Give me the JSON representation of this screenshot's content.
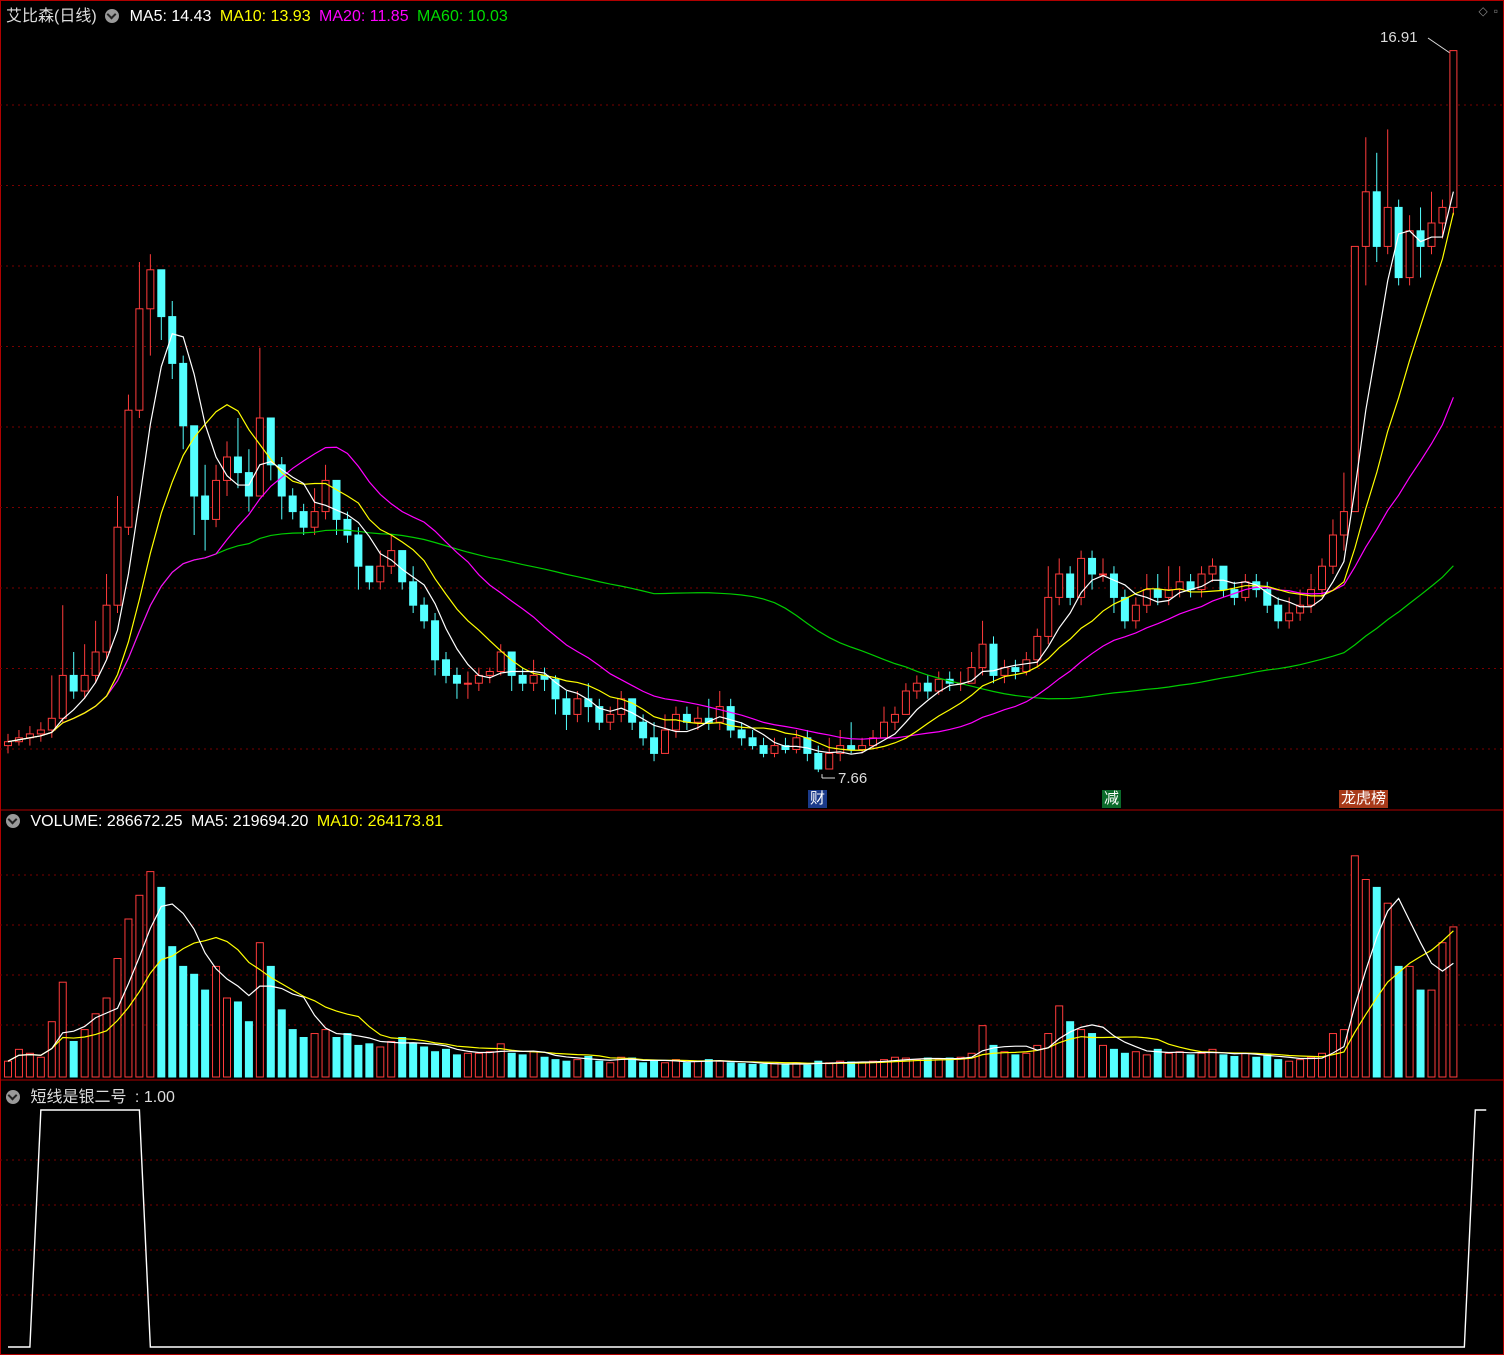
{
  "header": {
    "stock_name": "艾比森(日线)",
    "ma5": "MA5: 14.43",
    "ma10": "MA10: 13.93",
    "ma20": "MA20: 11.85",
    "ma60": "MA60: 10.03"
  },
  "volume_header": {
    "volume": "VOLUME: 286672.25",
    "ma5": "MA5: 219694.20",
    "ma10": "MA10: 264173.81"
  },
  "indicator_header": {
    "name": "短线是银二号",
    "value": ": 1.00"
  },
  "annotations": {
    "high_label": "16.91",
    "low_label": "7.66",
    "event_cai": "财",
    "event_jian": "减",
    "event_longhu": "龙虎榜"
  },
  "colors": {
    "up": "#ff3b3b",
    "down": "#54ffff",
    "ma5": "#ffffff",
    "ma10": "#ffff00",
    "ma20": "#ff00ff",
    "ma60": "#00cc00",
    "grid": "#7a0000",
    "panel_border": "#b00000"
  },
  "chart_data": {
    "type": "candlestick",
    "price_range": [
      7.2,
      17.2
    ],
    "candles": [
      [
        8.0,
        8.05,
        7.9,
        8.15
      ],
      [
        8.05,
        8.1,
        8.0,
        8.2
      ],
      [
        8.1,
        8.15,
        8.0,
        8.25
      ],
      [
        8.15,
        8.2,
        8.05,
        8.3
      ],
      [
        8.2,
        8.35,
        8.1,
        8.9
      ],
      [
        8.35,
        8.9,
        8.3,
        9.8
      ],
      [
        8.9,
        8.7,
        8.6,
        9.2
      ],
      [
        8.7,
        8.9,
        8.6,
        9.3
      ],
      [
        8.9,
        9.2,
        8.8,
        9.6
      ],
      [
        9.2,
        9.8,
        9.1,
        10.2
      ],
      [
        9.8,
        10.8,
        9.7,
        11.2
      ],
      [
        10.8,
        12.3,
        10.7,
        12.5
      ],
      [
        12.3,
        13.6,
        12.2,
        14.2
      ],
      [
        13.6,
        14.1,
        13.0,
        14.3
      ],
      [
        14.1,
        13.5,
        13.2,
        14.0
      ],
      [
        13.5,
        12.9,
        12.7,
        13.7
      ],
      [
        12.9,
        12.1,
        11.8,
        13.0
      ],
      [
        12.1,
        11.2,
        10.7,
        11.4
      ],
      [
        11.2,
        10.9,
        10.5,
        11.6
      ],
      [
        10.9,
        11.4,
        10.8,
        11.6
      ],
      [
        11.4,
        11.7,
        11.2,
        11.9
      ],
      [
        11.7,
        11.5,
        11.3,
        12.2
      ],
      [
        11.5,
        11.2,
        11.0,
        11.8
      ],
      [
        11.2,
        12.2,
        11.2,
        13.1
      ],
      [
        12.2,
        11.6,
        11.4,
        12.2
      ],
      [
        11.6,
        11.2,
        10.9,
        11.7
      ],
      [
        11.2,
        11.0,
        10.9,
        11.3
      ],
      [
        11.0,
        10.8,
        10.7,
        11.1
      ],
      [
        10.8,
        11.0,
        10.7,
        11.3
      ],
      [
        11.0,
        11.4,
        10.9,
        11.6
      ],
      [
        11.4,
        10.9,
        10.7,
        11.4
      ],
      [
        10.9,
        10.7,
        10.6,
        11.0
      ],
      [
        10.7,
        10.3,
        10.0,
        10.8
      ],
      [
        10.3,
        10.1,
        10.0,
        10.3
      ],
      [
        10.1,
        10.3,
        10.0,
        10.5
      ],
      [
        10.3,
        10.5,
        10.2,
        10.7
      ],
      [
        10.5,
        10.1,
        10.0,
        10.5
      ],
      [
        10.1,
        9.8,
        9.7,
        10.3
      ],
      [
        9.8,
        9.6,
        9.5,
        9.9
      ],
      [
        9.6,
        9.1,
        8.9,
        9.7
      ],
      [
        9.1,
        8.9,
        8.8,
        9.2
      ],
      [
        8.9,
        8.8,
        8.6,
        9.0
      ],
      [
        8.8,
        8.8,
        8.6,
        8.95
      ],
      [
        8.8,
        8.9,
        8.7,
        9.0
      ],
      [
        8.9,
        8.95,
        8.8,
        9.0
      ],
      [
        8.95,
        9.2,
        8.9,
        9.3
      ],
      [
        9.2,
        8.9,
        8.7,
        9.2
      ],
      [
        8.9,
        8.8,
        8.7,
        9.0
      ],
      [
        8.8,
        8.9,
        8.7,
        9.1
      ],
      [
        8.9,
        8.85,
        8.7,
        9.0
      ],
      [
        8.85,
        8.6,
        8.4,
        8.9
      ],
      [
        8.6,
        8.4,
        8.2,
        8.7
      ],
      [
        8.4,
        8.6,
        8.3,
        8.7
      ],
      [
        8.6,
        8.5,
        8.3,
        8.8
      ],
      [
        8.5,
        8.3,
        8.2,
        8.6
      ],
      [
        8.3,
        8.4,
        8.2,
        8.5
      ],
      [
        8.4,
        8.6,
        8.3,
        8.7
      ],
      [
        8.6,
        8.3,
        8.2,
        8.6
      ],
      [
        8.3,
        8.1,
        8.0,
        8.4
      ],
      [
        8.1,
        7.9,
        7.8,
        8.3
      ],
      [
        7.9,
        8.2,
        7.9,
        8.4
      ],
      [
        8.2,
        8.4,
        8.1,
        8.5
      ],
      [
        8.4,
        8.3,
        8.2,
        8.5
      ],
      [
        8.3,
        8.35,
        8.2,
        8.5
      ],
      [
        8.35,
        8.3,
        8.2,
        8.6
      ],
      [
        8.3,
        8.5,
        8.2,
        8.7
      ],
      [
        8.5,
        8.2,
        8.1,
        8.6
      ],
      [
        8.2,
        8.1,
        8.0,
        8.3
      ],
      [
        8.1,
        8.0,
        7.95,
        8.2
      ],
      [
        8.0,
        7.9,
        7.85,
        8.1
      ],
      [
        7.9,
        8.0,
        7.85,
        8.1
      ],
      [
        8.0,
        7.95,
        7.9,
        8.1
      ],
      [
        7.95,
        8.1,
        7.9,
        8.2
      ],
      [
        8.1,
        7.9,
        7.8,
        8.2
      ],
      [
        7.9,
        7.7,
        7.66,
        8.0
      ],
      [
        7.7,
        7.9,
        7.7,
        8.1
      ],
      [
        7.9,
        8.0,
        7.8,
        8.2
      ],
      [
        8.0,
        7.95,
        7.9,
        8.3
      ],
      [
        7.95,
        8.0,
        7.9,
        8.1
      ],
      [
        8.0,
        8.1,
        7.95,
        8.2
      ],
      [
        8.1,
        8.3,
        8.1,
        8.5
      ],
      [
        8.3,
        8.4,
        8.2,
        8.5
      ],
      [
        8.4,
        8.7,
        8.4,
        8.8
      ],
      [
        8.7,
        8.8,
        8.6,
        8.9
      ],
      [
        8.8,
        8.7,
        8.6,
        8.9
      ],
      [
        8.7,
        8.85,
        8.65,
        8.95
      ],
      [
        8.85,
        8.8,
        8.7,
        8.95
      ],
      [
        8.8,
        8.8,
        8.7,
        8.95
      ],
      [
        8.8,
        9.0,
        8.8,
        9.2
      ],
      [
        9.0,
        9.3,
        8.9,
        9.6
      ],
      [
        9.3,
        8.9,
        8.8,
        9.4
      ],
      [
        8.9,
        9.0,
        8.8,
        9.1
      ],
      [
        9.0,
        8.95,
        8.85,
        9.1
      ],
      [
        8.95,
        9.1,
        8.9,
        9.2
      ],
      [
        9.1,
        9.4,
        9.0,
        9.5
      ],
      [
        9.4,
        9.9,
        9.3,
        10.3
      ],
      [
        9.9,
        10.2,
        9.8,
        10.4
      ],
      [
        10.2,
        9.9,
        9.8,
        10.3
      ],
      [
        9.9,
        10.4,
        9.8,
        10.5
      ],
      [
        10.4,
        10.2,
        10.0,
        10.5
      ],
      [
        10.2,
        10.2,
        10.1,
        10.4
      ],
      [
        10.2,
        9.9,
        9.7,
        10.3
      ],
      [
        9.9,
        9.6,
        9.5,
        10.0
      ],
      [
        9.6,
        9.8,
        9.5,
        9.9
      ],
      [
        9.8,
        10.0,
        9.7,
        10.2
      ],
      [
        10.0,
        9.9,
        9.8,
        10.2
      ],
      [
        9.9,
        10.0,
        9.8,
        10.3
      ],
      [
        10.0,
        10.1,
        9.9,
        10.3
      ],
      [
        10.1,
        10.0,
        9.9,
        10.2
      ],
      [
        10.0,
        10.2,
        9.9,
        10.3
      ],
      [
        10.2,
        10.3,
        10.1,
        10.4
      ],
      [
        10.3,
        10.0,
        9.9,
        10.3
      ],
      [
        10.0,
        9.9,
        9.8,
        10.1
      ],
      [
        9.9,
        10.1,
        9.85,
        10.2
      ],
      [
        10.1,
        10.0,
        9.9,
        10.2
      ],
      [
        10.0,
        9.8,
        9.7,
        10.1
      ],
      [
        9.8,
        9.6,
        9.5,
        9.9
      ],
      [
        9.6,
        9.7,
        9.5,
        9.9
      ],
      [
        9.7,
        9.8,
        9.6,
        10.0
      ],
      [
        9.8,
        10.0,
        9.7,
        10.2
      ],
      [
        10.0,
        10.3,
        9.9,
        10.4
      ],
      [
        10.3,
        10.7,
        10.2,
        10.9
      ],
      [
        10.7,
        11.0,
        10.5,
        11.5
      ],
      [
        11.0,
        14.4,
        11.0,
        14.4
      ],
      [
        14.4,
        15.1,
        13.9,
        15.8
      ],
      [
        15.1,
        14.4,
        14.2,
        15.6
      ],
      [
        14.4,
        14.9,
        14.3,
        15.9
      ],
      [
        14.9,
        14.0,
        13.9,
        15.0
      ],
      [
        14.0,
        14.6,
        13.9,
        14.8
      ],
      [
        14.6,
        14.4,
        14.0,
        14.9
      ],
      [
        14.4,
        14.7,
        14.3,
        15.1
      ],
      [
        14.7,
        14.9,
        14.5,
        15.0
      ],
      [
        14.9,
        16.91,
        14.8,
        16.91
      ]
    ],
    "volume_range": [
      0,
      300000
    ],
    "volumes": [
      20000,
      35000,
      30000,
      25000,
      70000,
      120000,
      45000,
      60000,
      80000,
      100000,
      150000,
      200000,
      230000,
      260000,
      240000,
      165000,
      140000,
      130000,
      110000,
      140000,
      100000,
      95000,
      70000,
      170000,
      140000,
      85000,
      60000,
      50000,
      55000,
      60000,
      50000,
      55000,
      40000,
      42000,
      38000,
      45000,
      50000,
      42000,
      38000,
      32000,
      35000,
      28000,
      30000,
      30000,
      32000,
      42000,
      30000,
      28000,
      32000,
      25000,
      22000,
      20000,
      22000,
      26000,
      20000,
      18000,
      25000,
      24000,
      18000,
      20000,
      18000,
      22000,
      18000,
      20000,
      22000,
      20000,
      18000,
      17000,
      16000,
      16000,
      17000,
      16000,
      18000,
      15000,
      20000,
      18000,
      20000,
      19000,
      18000,
      20000,
      22000,
      25000,
      24000,
      22000,
      24000,
      22000,
      24000,
      25000,
      30000,
      65000,
      40000,
      32000,
      28000,
      30000,
      40000,
      55000,
      90000,
      70000,
      60000,
      55000,
      40000,
      35000,
      30000,
      32000,
      28000,
      35000,
      30000,
      32000,
      28000,
      30000,
      35000,
      28000,
      26000,
      30000,
      25000,
      28000,
      22000,
      20000,
      22000,
      25000,
      30000,
      55000,
      60000,
      280000,
      250000,
      240000,
      220000,
      140000,
      140000,
      110000,
      110000,
      170000,
      190000
    ],
    "indicator_range": [
      0,
      1
    ],
    "indicator": [
      0,
      0,
      0,
      1,
      1,
      1,
      1,
      1,
      1,
      1,
      1,
      1,
      1,
      0,
      0,
      0,
      0,
      0,
      0,
      0,
      0,
      0,
      0,
      0,
      0,
      0,
      0,
      0,
      0,
      0,
      0,
      0,
      0,
      0,
      0,
      0,
      0,
      0,
      0,
      0,
      0,
      0,
      0,
      0,
      0,
      0,
      0,
      0,
      0,
      0,
      0,
      0,
      0,
      0,
      0,
      0,
      0,
      0,
      0,
      0,
      0,
      0,
      0,
      0,
      0,
      0,
      0,
      0,
      0,
      0,
      0,
      0,
      0,
      0,
      0,
      0,
      0,
      0,
      0,
      0,
      0,
      0,
      0,
      0,
      0,
      0,
      0,
      0,
      0,
      0,
      0,
      0,
      0,
      0,
      0,
      0,
      0,
      0,
      0,
      0,
      0,
      0,
      0,
      0,
      0,
      0,
      0,
      0,
      0,
      0,
      0,
      0,
      0,
      0,
      0,
      0,
      0,
      0,
      0,
      0,
      0,
      0,
      0,
      0,
      0,
      0,
      0,
      0,
      0,
      0,
      0,
      0,
      0,
      0,
      1,
      1
    ]
  }
}
